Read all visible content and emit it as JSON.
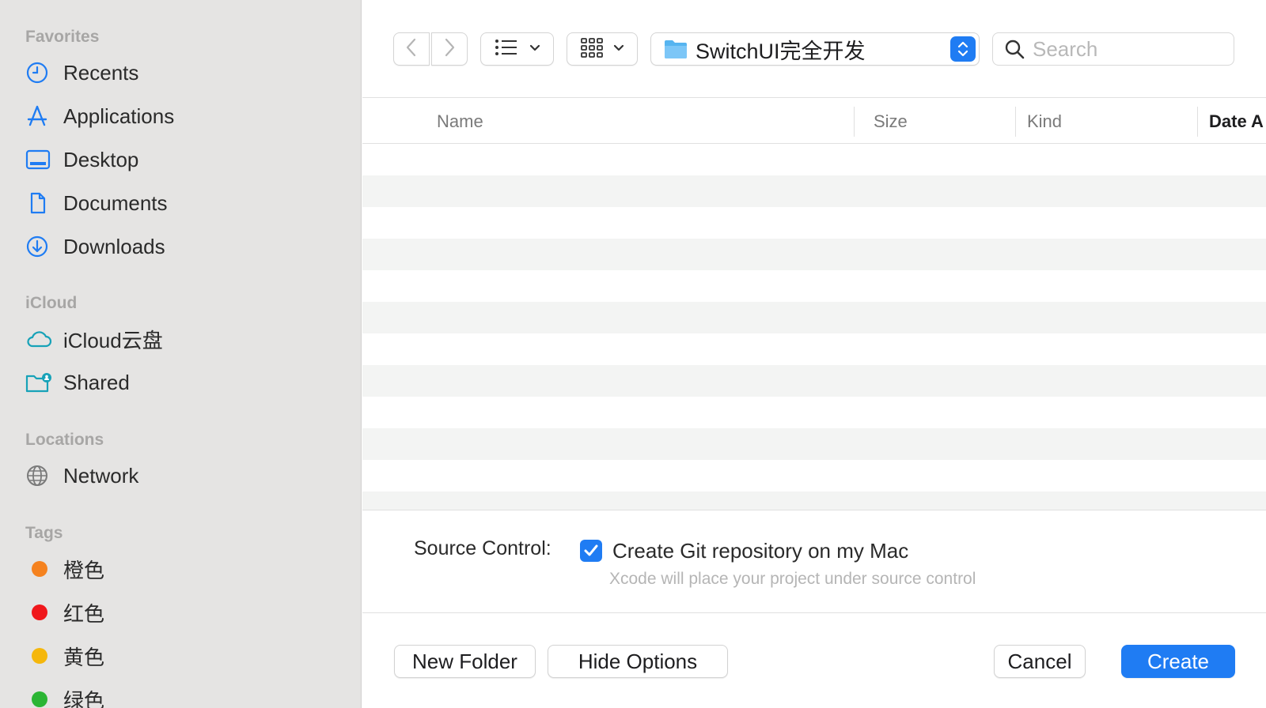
{
  "sidebar": {
    "favorites_heading": "Favorites",
    "favorites": [
      {
        "label": "Recents",
        "icon": "clock-icon"
      },
      {
        "label": "Applications",
        "icon": "applications-icon"
      },
      {
        "label": "Desktop",
        "icon": "desktop-icon"
      },
      {
        "label": "Documents",
        "icon": "document-icon"
      },
      {
        "label": "Downloads",
        "icon": "download-icon"
      }
    ],
    "icloud_heading": "iCloud",
    "icloud": [
      {
        "label": "iCloud云盘",
        "icon": "cloud-icon"
      },
      {
        "label": "Shared",
        "icon": "shared-folder-icon"
      }
    ],
    "locations_heading": "Locations",
    "locations": [
      {
        "label": "Network",
        "icon": "globe-icon"
      }
    ],
    "tags_heading": "Tags",
    "tags": [
      {
        "label": "橙色",
        "color": "#f5821f"
      },
      {
        "label": "红色",
        "color": "#f0171b"
      },
      {
        "label": "黄色",
        "color": "#f5b70c"
      },
      {
        "label": "绿色",
        "color": "#2bb534"
      }
    ]
  },
  "toolbar": {
    "back_icon": "chevron-left-icon",
    "forward_icon": "chevron-right-icon",
    "list_view_icon": "list-icon",
    "grid_view_icon": "grid-icon",
    "current_folder": "SwitchUI完全开发",
    "search_placeholder": "Search"
  },
  "table": {
    "columns": [
      "Name",
      "Size",
      "Kind",
      "Date A"
    ]
  },
  "options": {
    "source_control_label": "Source Control:",
    "checkbox_label": "Create Git repository on my Mac",
    "checkbox_checked": true,
    "checkbox_hint": "Xcode will place your project under source control"
  },
  "buttons": {
    "new_folder": "New Folder",
    "hide_options": "Hide Options",
    "cancel": "Cancel",
    "create": "Create"
  },
  "colors": {
    "accent": "#1f7cf3",
    "sidebar_bg": "#e5e4e3",
    "row_alt": "#f3f4f3"
  }
}
